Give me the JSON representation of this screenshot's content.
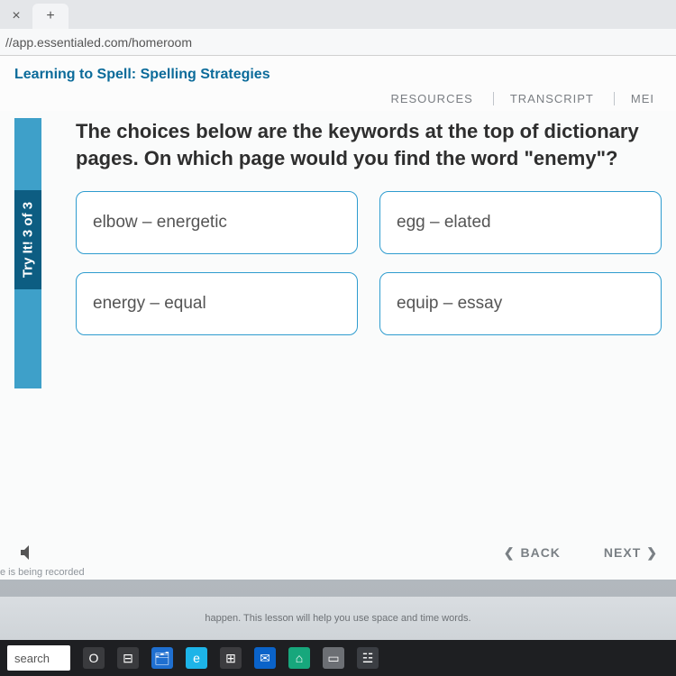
{
  "browser": {
    "close_glyph": "×",
    "add_glyph": "+",
    "url": "//app.essentialed.com/homeroom"
  },
  "lesson": {
    "title": "Learning to Spell: Spelling Strategies",
    "tools": {
      "resources": "RESOURCES",
      "transcript": "TRANSCRIPT",
      "menu": "MEI"
    }
  },
  "sidebar": {
    "label": "Try It! 3 of 3"
  },
  "question": "The choices below are the keywords at the top of dictionary pages. On which page would you find the word \"enemy\"?",
  "choices": [
    "elbow – energetic",
    "egg – elated",
    "energy – equal",
    "equip – essay"
  ],
  "nav": {
    "back": "BACK",
    "next": "NEXT",
    "back_glyph": "❮",
    "next_glyph": "❯"
  },
  "recording_note": "e is being recorded",
  "peek_text": "happen. This lesson will help you use space and time words.",
  "taskbar": {
    "search": "search",
    "icons": [
      "O",
      "⊟",
      "🗂",
      "e",
      "⊞",
      "✉",
      "⌂",
      "▭",
      "☳"
    ]
  }
}
